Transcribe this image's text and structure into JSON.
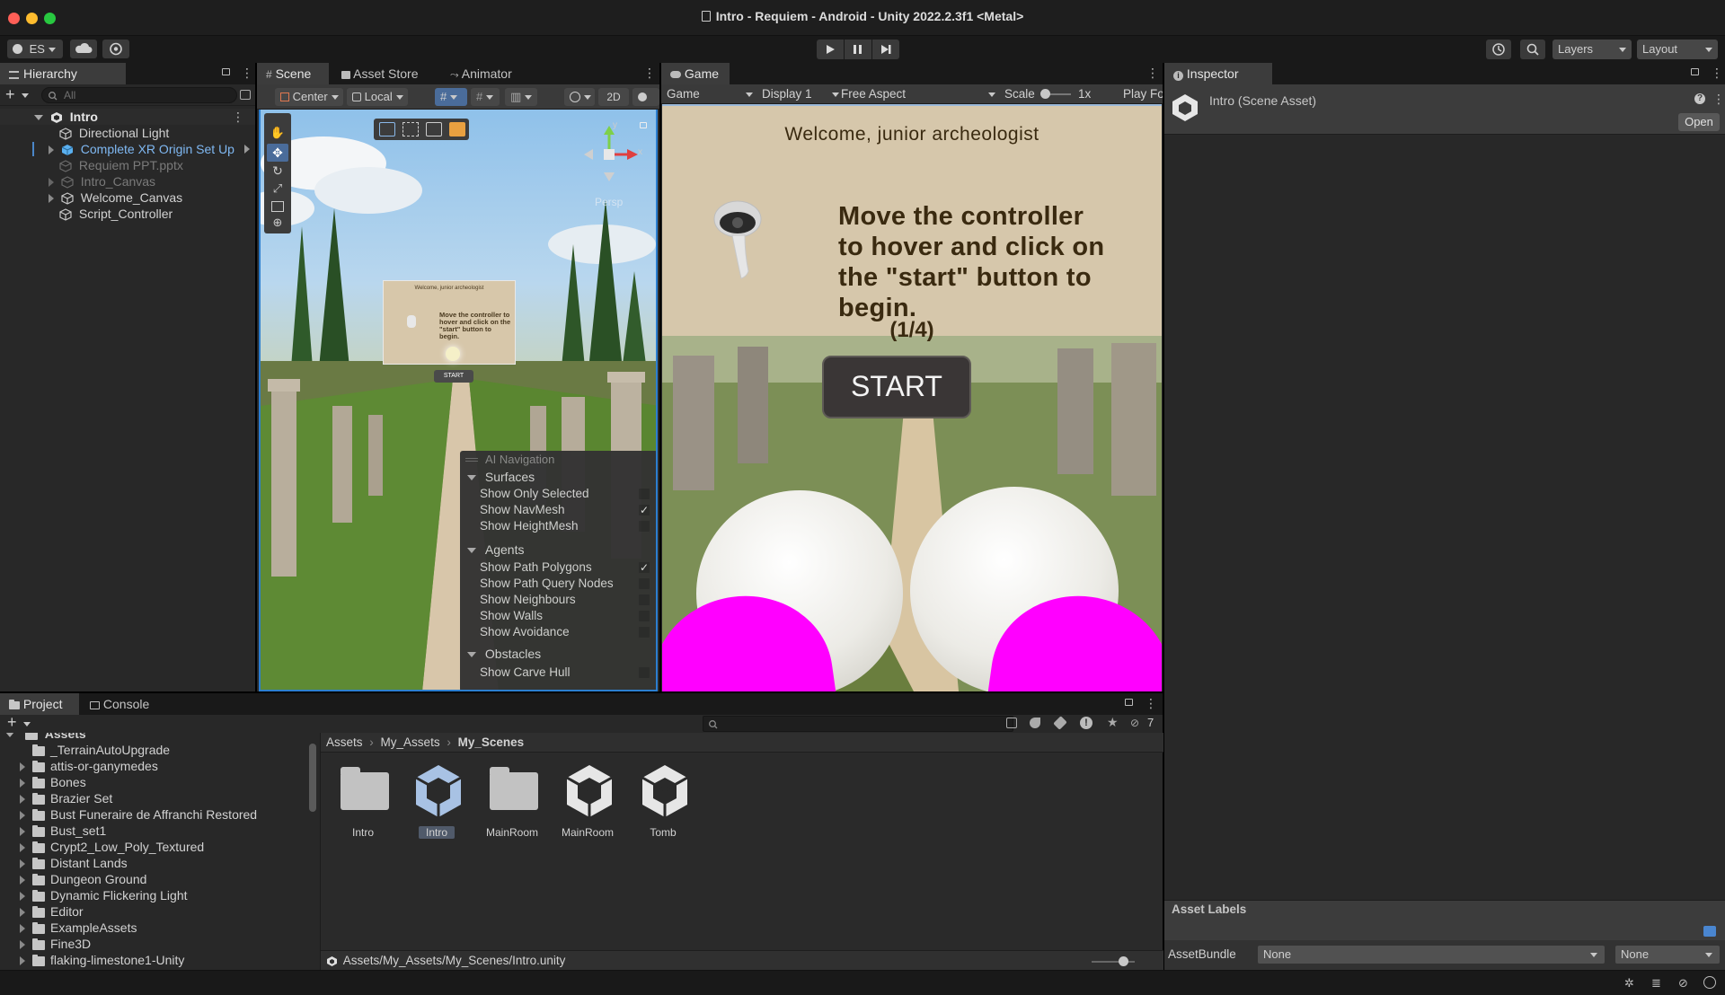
{
  "window": {
    "title": "Intro - Requiem - Android - Unity 2022.2.3f1 <Metal>",
    "account": "ES",
    "layers_label": "Layers",
    "layout_label": "Layout"
  },
  "hierarchy": {
    "tab": "Hierarchy",
    "search_placeholder": "All",
    "scene_name": "Intro",
    "items": [
      {
        "label": "Directional Light",
        "state": "normal"
      },
      {
        "label": "Complete XR Origin Set Up",
        "state": "prefab"
      },
      {
        "label": "Requiem PPT.pptx",
        "state": "disabled"
      },
      {
        "label": "Intro_Canvas",
        "state": "disabled"
      },
      {
        "label": "Welcome_Canvas",
        "state": "normal"
      },
      {
        "label": "Script_Controller",
        "state": "normal"
      }
    ]
  },
  "scene_view": {
    "tabs": [
      "Scene",
      "Asset Store",
      "Animator"
    ],
    "pivot": "Center",
    "space": "Local",
    "mode_2d": "2D",
    "gizmo_axes": {
      "y": "y",
      "x": "x"
    },
    "persp": "Persp",
    "mini_canvas": {
      "welcome": "Welcome, junior archeologist",
      "instruction": "Move the controller to hover and click on the \"start\" button to begin.",
      "start": "START"
    },
    "ai_navigation": {
      "title": "AI Navigation",
      "sections": [
        {
          "title": "Surfaces",
          "options": [
            {
              "label": "Show Only Selected",
              "checked": false
            },
            {
              "label": "Show NavMesh",
              "checked": true
            },
            {
              "label": "Show HeightMesh",
              "checked": false
            }
          ]
        },
        {
          "title": "Agents",
          "options": [
            {
              "label": "Show Path Polygons",
              "checked": true
            },
            {
              "label": "Show Path Query Nodes",
              "checked": false
            },
            {
              "label": "Show Neighbours",
              "checked": false
            },
            {
              "label": "Show Walls",
              "checked": false
            },
            {
              "label": "Show Avoidance",
              "checked": false
            }
          ]
        },
        {
          "title": "Obstacles",
          "options": [
            {
              "label": "Show Carve Hull",
              "checked": false
            }
          ]
        }
      ]
    }
  },
  "game_view": {
    "tab": "Game",
    "mode": "Game",
    "display": "Display 1",
    "aspect": "Free Aspect",
    "scale_label": "Scale",
    "scale_value": "1x",
    "play_focused": "Play Fo",
    "welcome": "Welcome, junior archeologist",
    "instruction": "Move the controller to hover and click on the \"start\" button to begin.",
    "page": "(1/4)",
    "start": "START"
  },
  "inspector": {
    "tab": "Inspector",
    "asset_title": "Intro (Scene Asset)",
    "open_button": "Open",
    "asset_labels": "Asset Labels",
    "asset_bundle_label": "AssetBundle",
    "asset_bundle_value": "None",
    "asset_bundle_variant": "None"
  },
  "project": {
    "tabs": [
      "Project",
      "Console"
    ],
    "root": "Assets",
    "folders": [
      "_TerrainAutoUpgrade",
      "attis-or-ganymedes",
      "Bones",
      "Brazier Set",
      "Bust Funeraire de Affranchi Restored",
      "Bust_set1",
      "Crypt2_Low_Poly_Textured",
      "Distant Lands",
      "Dungeon Ground",
      "Dynamic Flickering Light",
      "Editor",
      "ExampleAssets",
      "Fine3D",
      "flaking-limestone1-Unity"
    ],
    "breadcrumb": [
      "Assets",
      "My_Assets",
      "My_Scenes"
    ],
    "hidden_count": "7",
    "assets": [
      {
        "label": "Intro",
        "kind": "folder"
      },
      {
        "label": "Intro",
        "kind": "scene",
        "selected": true
      },
      {
        "label": "MainRoom",
        "kind": "folder"
      },
      {
        "label": "MainRoom",
        "kind": "scene"
      },
      {
        "label": "Tomb",
        "kind": "scene"
      }
    ],
    "path": "Assets/My_Assets/My_Scenes/Intro.unity"
  }
}
